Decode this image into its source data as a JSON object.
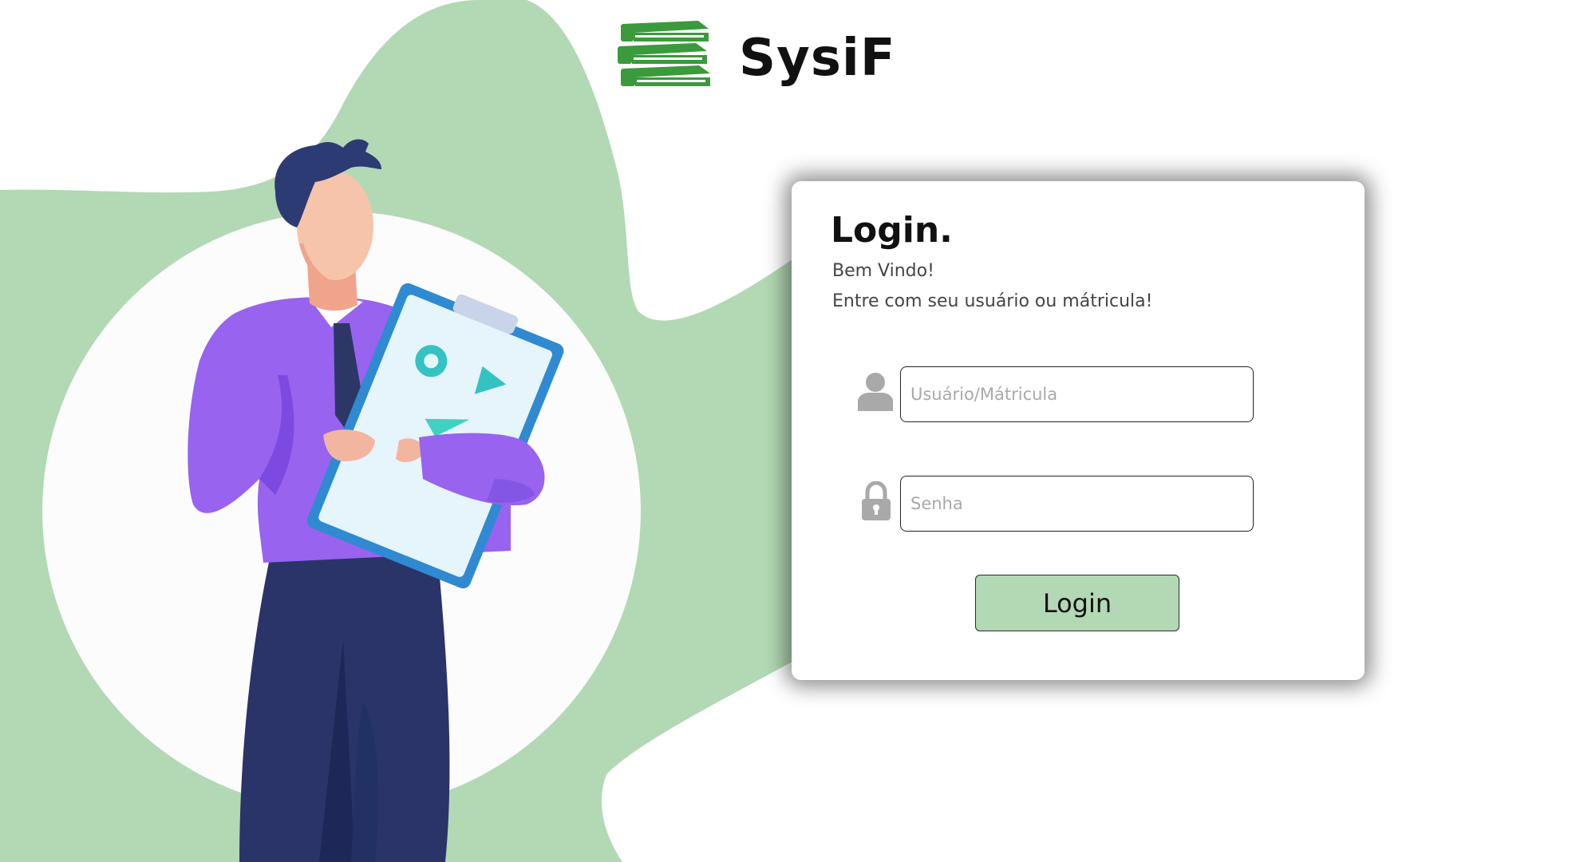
{
  "brand": {
    "name": "SysiF",
    "logo_icon": "books-stack-icon",
    "logo_color": "#3a9a3c"
  },
  "illustration": {
    "description_icon": "businessman-with-clipboard-illustration",
    "blob_color": "#b3d8b4"
  },
  "login": {
    "title": "Login.",
    "welcome": "Bem Vindo!",
    "instruction": "Entre com seu usuário ou mátricula!",
    "username_icon": "user-icon",
    "username_placeholder": "Usuário/Mátricula",
    "username_value": "",
    "password_icon": "lock-icon",
    "password_placeholder": "Senha",
    "password_value": "",
    "button_label": "Login",
    "button_color": "#b3d8b4"
  }
}
